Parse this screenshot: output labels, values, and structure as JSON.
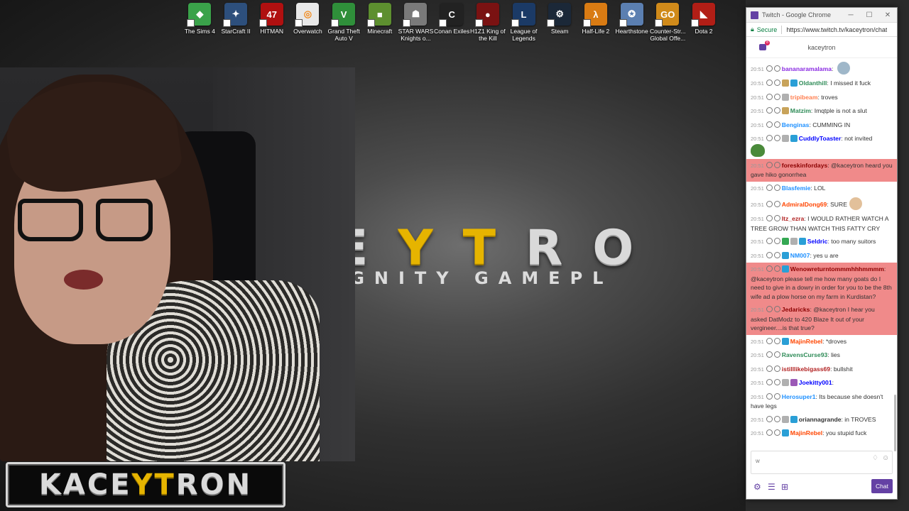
{
  "desktop": {
    "icons": [
      {
        "label": "The Sims 4",
        "icon": "sims-icon",
        "color": "#3aa24a",
        "glyph": "◆"
      },
      {
        "label": "StarCraft II",
        "icon": "starcraft-icon",
        "color": "#2d4f7c",
        "glyph": "✦"
      },
      {
        "label": "HITMAN",
        "icon": "hitman-icon",
        "color": "#b01010",
        "glyph": "47"
      },
      {
        "label": "Overwatch",
        "icon": "overwatch-icon",
        "color": "#e8e8e8",
        "glyph": "◎"
      },
      {
        "label": "Grand Theft Auto V",
        "icon": "gta-icon",
        "color": "#2f8f3a",
        "glyph": "V"
      },
      {
        "label": "Minecraft",
        "icon": "minecraft-icon",
        "color": "#5d8f2f",
        "glyph": "■"
      },
      {
        "label": "STAR WARS Knights o...",
        "icon": "starwars-icon",
        "color": "#7a7a7a",
        "glyph": "☗"
      },
      {
        "label": "Conan Exiles",
        "icon": "conan-icon",
        "color": "#222222",
        "glyph": "C"
      },
      {
        "label": "H1Z1 King of the Kill",
        "icon": "h1z1-icon",
        "color": "#7a1212",
        "glyph": "●"
      },
      {
        "label": "League of Legends",
        "icon": "league-icon",
        "color": "#1b3a66",
        "glyph": "L"
      },
      {
        "label": "Steam",
        "icon": "steam-icon",
        "color": "#1b2838",
        "glyph": "⚙"
      },
      {
        "label": "Half-Life 2",
        "icon": "halflife-icon",
        "color": "#d97b13",
        "glyph": "λ"
      },
      {
        "label": "Hearthstone",
        "icon": "hearthstone-icon",
        "color": "#5b7fb1",
        "glyph": "✪"
      },
      {
        "label": "Counter-Str... Global Offe...",
        "icon": "csgo-icon",
        "color": "#d08a1a",
        "glyph": "GO"
      },
      {
        "label": "Dota 2",
        "icon": "dota-icon",
        "color": "#b21e16",
        "glyph": "◣"
      }
    ],
    "banner": {
      "pre": "CE",
      "y1": "Y",
      "t": "T",
      "post": "RO",
      "tagline": "CT DIGNITY GAMEPL"
    },
    "logo": {
      "pre": "KACE",
      "hl": "YT",
      "post": "RON"
    }
  },
  "browser": {
    "title": "Twitch - Google Chrome",
    "secure_label": "Secure",
    "url": "https://www.twitch.tv/kaceytron/chat",
    "channel": "kaceytron",
    "notif_count": "8"
  },
  "chat": {
    "messages": [
      {
        "ts": "20:51",
        "name": "bananaramalama",
        "color": "#8a2be2",
        "text": "",
        "badges": [],
        "emote": "gray",
        "hl": false
      },
      {
        "ts": "20:51",
        "name": "Oldanthill",
        "color": "#2e8b57",
        "text": "I missed it fuck",
        "badges": [
          "gold",
          "sub"
        ],
        "emote": "",
        "hl": false
      },
      {
        "ts": "20:51",
        "name": "tripibeam",
        "color": "#ff7f50",
        "text": "troves",
        "badges": [
          "bits"
        ],
        "emote": "",
        "hl": false
      },
      {
        "ts": "20:51",
        "name": "Matzim",
        "color": "#2e8b57",
        "text": "Imqtple is not a slut",
        "badges": [
          "gold"
        ],
        "emote": "",
        "hl": false
      },
      {
        "ts": "20:51",
        "name": "Benginas",
        "color": "#1e90ff",
        "text": "CUMMING IN",
        "badges": [],
        "emote": "",
        "hl": false
      },
      {
        "ts": "20:51",
        "name": "CuddlyToaster",
        "color": "#0000ff",
        "text": "not invited",
        "badges": [
          "bits",
          "sub"
        ],
        "emote": "pepe",
        "hl": false
      },
      {
        "ts": "20:51",
        "name": "foreskinfordays",
        "color": "#8b0000",
        "text": "@kaceytron heard you gave hiko gonorrhea",
        "badges": [],
        "emote": "",
        "hl": true
      },
      {
        "ts": "20:51",
        "name": "Blasfemie",
        "color": "#1e90ff",
        "text": "LOL",
        "badges": [],
        "emote": "",
        "hl": false
      },
      {
        "ts": "20:51",
        "name": "AdmiralDong69",
        "color": "#ff4500",
        "text": "SURE",
        "badges": [],
        "emote": "tan",
        "hl": false
      },
      {
        "ts": "20:51",
        "name": "Itz_ezra",
        "color": "#b22222",
        "text": "I WOULD RATHER WATCH A TREE GROW THAN WATCH THIS FATTY CRY",
        "badges": [],
        "emote": "",
        "hl": false
      },
      {
        "ts": "20:51",
        "name": "Seldric",
        "color": "#0000ff",
        "text": "too many suitors",
        "badges": [
          "mod2",
          "bits",
          "sub"
        ],
        "emote": "",
        "hl": false
      },
      {
        "ts": "20:51",
        "name": "NM007",
        "color": "#1e90ff",
        "text": "yes u are",
        "badges": [
          "sub"
        ],
        "emote": "",
        "hl": false
      },
      {
        "ts": "20:51",
        "name": "Wenowreturntommmhhhmmmm",
        "color": "#8b0000",
        "text": "@kaceytron please tell me how many goats do I need to give in a dowry in order for you to be the 8th wife ad a plow horse on my farm in Kurdistan?",
        "badges": [
          "sub"
        ],
        "emote": "",
        "hl": true
      },
      {
        "ts": "20:51",
        "name": "Jedaricks",
        "color": "#8b0000",
        "text": "@kaceytron I hear you asked DatModz to 420 Blaze It out of your vergineer....is that true?",
        "badges": [],
        "emote": "",
        "hl": true
      },
      {
        "ts": "20:51",
        "name": "MajinRebel",
        "color": "#ff4500",
        "text": "*droves",
        "badges": [
          "sub"
        ],
        "emote": "",
        "hl": false
      },
      {
        "ts": "20:51",
        "name": "RavensCurse93",
        "color": "#2e8b57",
        "text": "lies",
        "badges": [],
        "emote": "",
        "hl": false
      },
      {
        "ts": "20:51",
        "name": "istilllikebigass69",
        "color": "#b22222",
        "text": "bullshit",
        "badges": [],
        "emote": "",
        "hl": false
      },
      {
        "ts": "20:51",
        "name": "Joekitty001",
        "color": "#0000ff",
        "text": "",
        "badges": [
          "bits",
          "prime"
        ],
        "emote": "face",
        "hl": false
      },
      {
        "ts": "20:51",
        "name": "Herosuper1",
        "color": "#1e90ff",
        "text": "Its because she doesn't have legs",
        "badges": [],
        "emote": "",
        "hl": false
      },
      {
        "ts": "20:51",
        "name": "oriannagrande",
        "color": "#333333",
        "text": "in TROVES",
        "badges": [
          "bits",
          "sub"
        ],
        "emote": "",
        "hl": false
      },
      {
        "ts": "20:51",
        "name": "MajinRebel",
        "color": "#ff4500",
        "text": "you stupid fuck",
        "badges": [
          "sub"
        ],
        "emote": "",
        "hl": false
      }
    ],
    "input_value": "w",
    "send_label": "Chat"
  }
}
